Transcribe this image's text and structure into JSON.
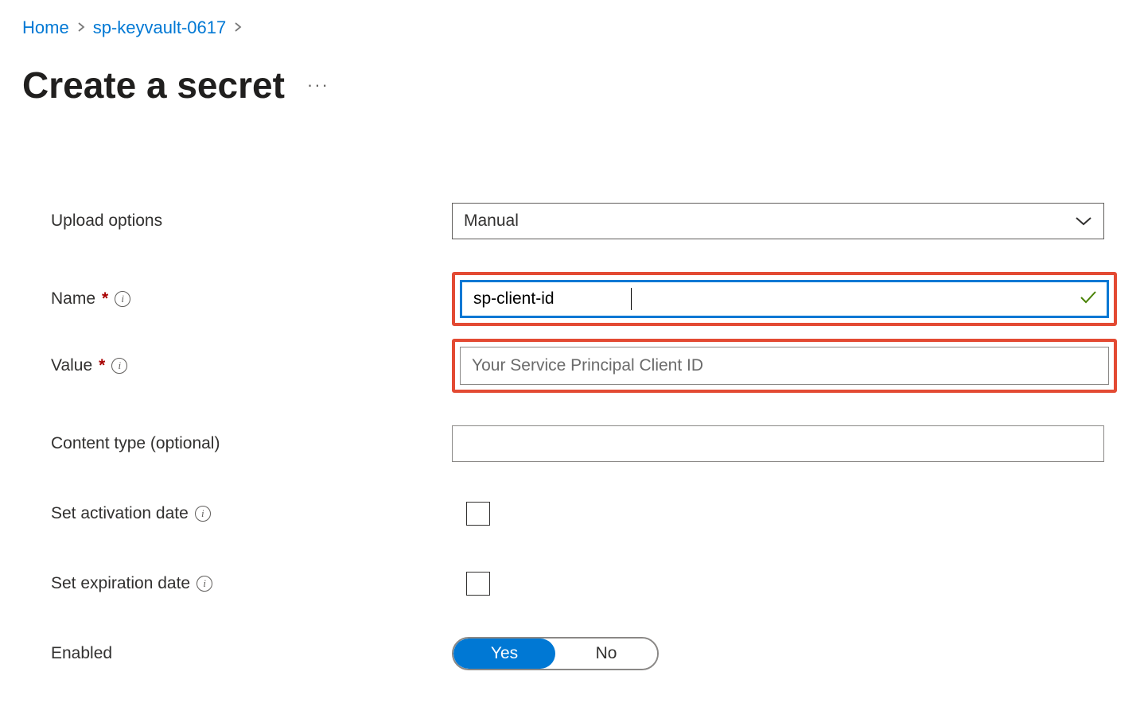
{
  "breadcrumb": {
    "home": "Home",
    "resource": "sp-keyvault-0617"
  },
  "page": {
    "title": "Create a secret"
  },
  "form": {
    "upload_options": {
      "label": "Upload options",
      "value": "Manual"
    },
    "name": {
      "label": "Name",
      "value": "sp-client-id"
    },
    "value_field": {
      "label": "Value",
      "placeholder": "Your Service Principal Client ID"
    },
    "content_type": {
      "label": "Content type (optional)",
      "value": ""
    },
    "activation": {
      "label": "Set activation date"
    },
    "expiration": {
      "label": "Set expiration date"
    },
    "enabled": {
      "label": "Enabled",
      "yes": "Yes",
      "no": "No",
      "selected": "Yes"
    }
  }
}
